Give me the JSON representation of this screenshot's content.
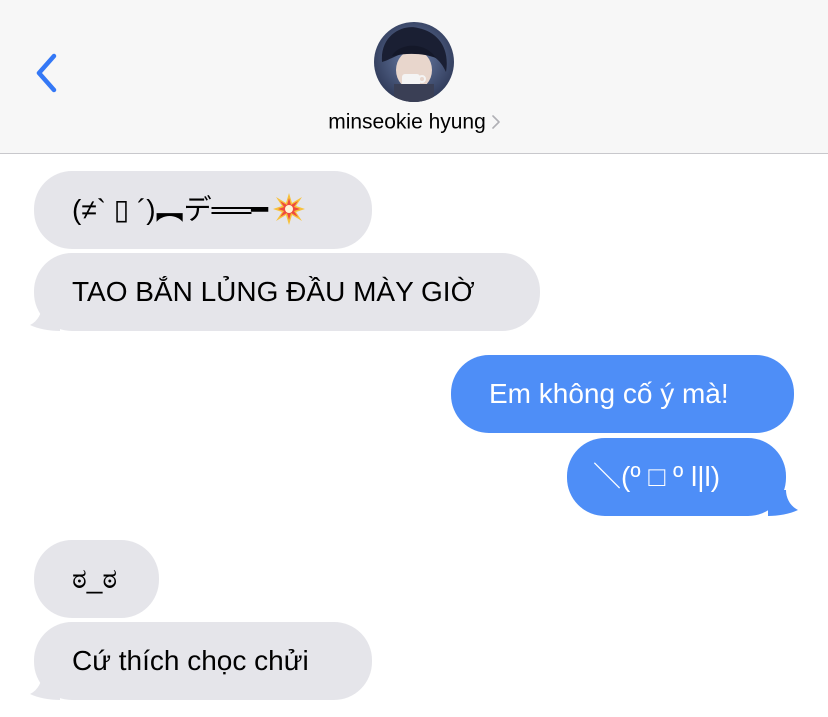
{
  "header": {
    "contact_name": "minseokie hyung",
    "back_icon": "chevron-left-icon",
    "chevron_icon": "chevron-right-icon",
    "accent_color": "#3478f6"
  },
  "messages": [
    {
      "side": "received",
      "text": "(≠` ▯ ´)︻デ══━"
    },
    {
      "side": "received",
      "text": "TAO BẮN LỦNG ĐẦU MÀY GIỜ"
    },
    {
      "side": "sent",
      "text": "Em không cố ý mà!"
    },
    {
      "side": "sent",
      "text": "＼(º □ º l|l)"
    },
    {
      "side": "received",
      "text": "ಠ_ಠ"
    },
    {
      "side": "received",
      "text": "Cứ thích chọc chửi"
    }
  ],
  "colors": {
    "received_bubble": "#e5e5ea",
    "sent_bubble": "#4e8ef7"
  }
}
